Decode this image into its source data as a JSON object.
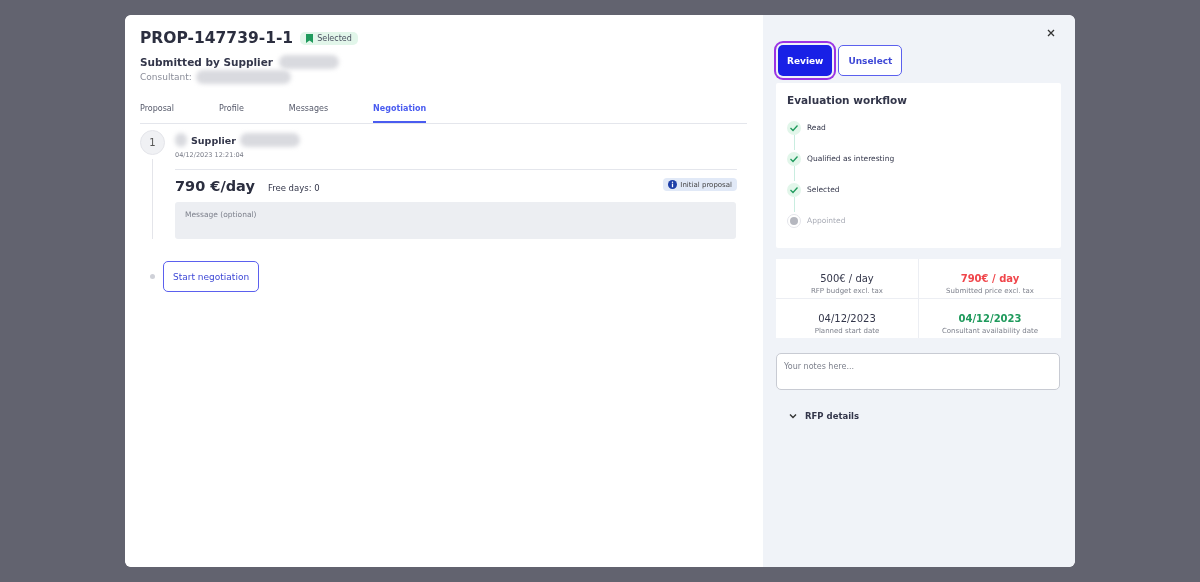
{
  "proposal": {
    "title": "PROP-147739-1-1",
    "status_badge": "Selected",
    "submitted_by": "Submitted by Supplier",
    "consultant_label": "Consultant:"
  },
  "tabs": [
    {
      "label": "Proposal",
      "selected": false
    },
    {
      "label": "Profile",
      "selected": false
    },
    {
      "label": "Messages",
      "selected": false
    },
    {
      "label": "Negotiation",
      "selected": true
    }
  ],
  "negotiation": {
    "step": "1",
    "author": "Supplier",
    "timestamp": "04/12/2023 12:21:04",
    "price": "790 €/day",
    "free_days": "Free days: 0",
    "badge": "Initial proposal",
    "message": {
      "placeholder": "Message (optional)"
    },
    "start_button": "Start negotiation"
  },
  "actions": [
    {
      "label": "Review",
      "kind": "primary"
    },
    {
      "label": "Unselect",
      "kind": "outline"
    }
  ],
  "workflow": {
    "title": "Evaluation workflow",
    "steps": [
      {
        "label": "Read",
        "done": true
      },
      {
        "label": "Qualified as interesting",
        "done": true
      },
      {
        "label": "Selected",
        "done": true
      },
      {
        "label": "Appointed",
        "done": false
      }
    ]
  },
  "metrics": [
    {
      "value": "500€ / day",
      "caption": "RFP budget excl. tax",
      "color": "#33364a"
    },
    {
      "value": "790€ / day",
      "caption": "Submitted price excl. tax",
      "color": "#f0464b"
    },
    {
      "value": "04/12/2023",
      "caption": "Planned start date",
      "color": "#33364a"
    },
    {
      "value": "04/12/2023",
      "caption": "Consultant availability date",
      "color": "#1f9a5c"
    }
  ],
  "notes": {
    "placeholder": "Your notes here..."
  },
  "rfp_details": {
    "label": "RFP details",
    "expanded": false
  }
}
